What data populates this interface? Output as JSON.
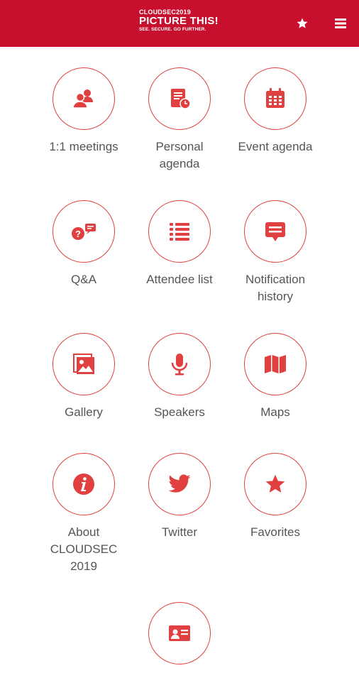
{
  "header": {
    "logo_top": "CLOUDSEC2019",
    "logo_main": "PICTURE THIS!",
    "logo_tag": "SEE. SECURE. GO FURTHER.",
    "favorites_icon": "star-icon",
    "menu_icon": "menu-icon"
  },
  "colors": {
    "brand": "#c8102e",
    "icon": "#e0403f",
    "label": "#555555"
  },
  "tiles": [
    {
      "label": "1:1 meetings",
      "icon": "users-icon"
    },
    {
      "label": "Personal\nagenda",
      "icon": "personal-agenda-icon"
    },
    {
      "label": "Event agenda",
      "icon": "calendar-icon"
    },
    {
      "label": "Q&A",
      "icon": "qa-icon"
    },
    {
      "label": "Attendee list",
      "icon": "list-icon"
    },
    {
      "label": "Notification\nhistory",
      "icon": "notification-icon"
    },
    {
      "label": "Gallery",
      "icon": "gallery-icon"
    },
    {
      "label": "Speakers",
      "icon": "microphone-icon"
    },
    {
      "label": "Maps",
      "icon": "map-icon"
    },
    {
      "label": "About\nCLOUDSEC\n2019",
      "icon": "info-icon"
    },
    {
      "label": "Twitter",
      "icon": "twitter-icon"
    },
    {
      "label": "Favorites",
      "icon": "star-icon"
    },
    {
      "label": "",
      "icon": "id-card-icon"
    }
  ]
}
